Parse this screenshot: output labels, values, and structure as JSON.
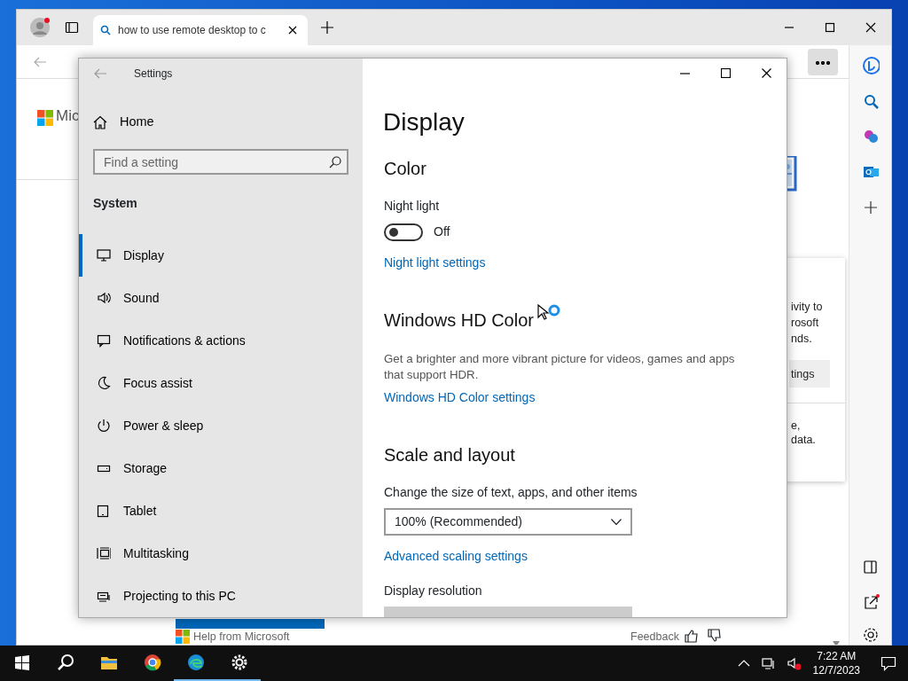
{
  "browser": {
    "tabs": [
      {
        "title": "how to use remote desktop to c",
        "selected": true
      }
    ],
    "page": {
      "logo_text": "Mic",
      "card_lines": [
        "ivity to",
        "rosoft",
        "nds."
      ],
      "card_button": "tings",
      "card_lines_2": [
        "e,",
        "data."
      ],
      "help_link": "Help from Microsoft",
      "feedback": "Feedback"
    }
  },
  "settings": {
    "title": "Settings",
    "home": "Home",
    "search": {
      "placeholder": "Find a setting"
    },
    "group": "System",
    "nav": [
      {
        "label": "Display",
        "selected": true
      },
      {
        "label": "Sound",
        "selected": false
      },
      {
        "label": "Notifications & actions",
        "selected": false
      },
      {
        "label": "Focus assist",
        "selected": false
      },
      {
        "label": "Power & sleep",
        "selected": false
      },
      {
        "label": "Storage",
        "selected": false
      },
      {
        "label": "Tablet",
        "selected": false
      },
      {
        "label": "Multitasking",
        "selected": false
      },
      {
        "label": "Projecting to this PC",
        "selected": false
      }
    ],
    "page_title": "Display",
    "blocks": [
      {
        "kind": "heading",
        "text": "Color"
      },
      {
        "kind": "label",
        "text": "Night light"
      },
      {
        "kind": "toggle",
        "text": "Off",
        "on": false
      },
      {
        "kind": "link",
        "text": "Night light settings"
      },
      {
        "kind": "heading",
        "text": "Windows HD Color"
      },
      {
        "kind": "text",
        "text": "Get a brighter and more vibrant picture for videos, games and apps that support HDR."
      },
      {
        "kind": "link",
        "text": "Windows HD Color settings"
      },
      {
        "kind": "heading",
        "text": "Scale and layout"
      },
      {
        "kind": "label",
        "text": "Change the size of text, apps, and other items"
      },
      {
        "kind": "dropdown",
        "text": "100% (Recommended)",
        "disabled": false
      },
      {
        "kind": "link",
        "text": "Advanced scaling settings"
      },
      {
        "kind": "label",
        "text": "Display resolution"
      },
      {
        "kind": "dropdown",
        "disabled": true
      }
    ]
  },
  "taskbar": {
    "apps": [
      {
        "open": false
      },
      {
        "open": false
      },
      {
        "open": false
      },
      {
        "open": false
      },
      {
        "open": true
      },
      {
        "open": true
      }
    ],
    "time": "7:22 AM",
    "date": "12/7/2023"
  }
}
